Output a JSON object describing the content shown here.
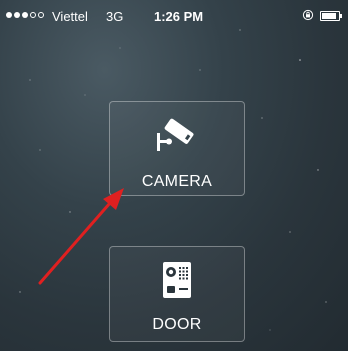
{
  "status_bar": {
    "signal_dots_filled": 3,
    "signal_dots_total": 5,
    "carrier": "Viettel",
    "network": "3G",
    "time": "1:26 PM",
    "battery_level": 0.9
  },
  "tiles": {
    "camera": {
      "label": "CAMERA",
      "icon": "security-camera-icon"
    },
    "door": {
      "label": "DOOR",
      "icon": "intercom-icon"
    }
  },
  "annotation": {
    "arrow_color": "#e02020"
  }
}
